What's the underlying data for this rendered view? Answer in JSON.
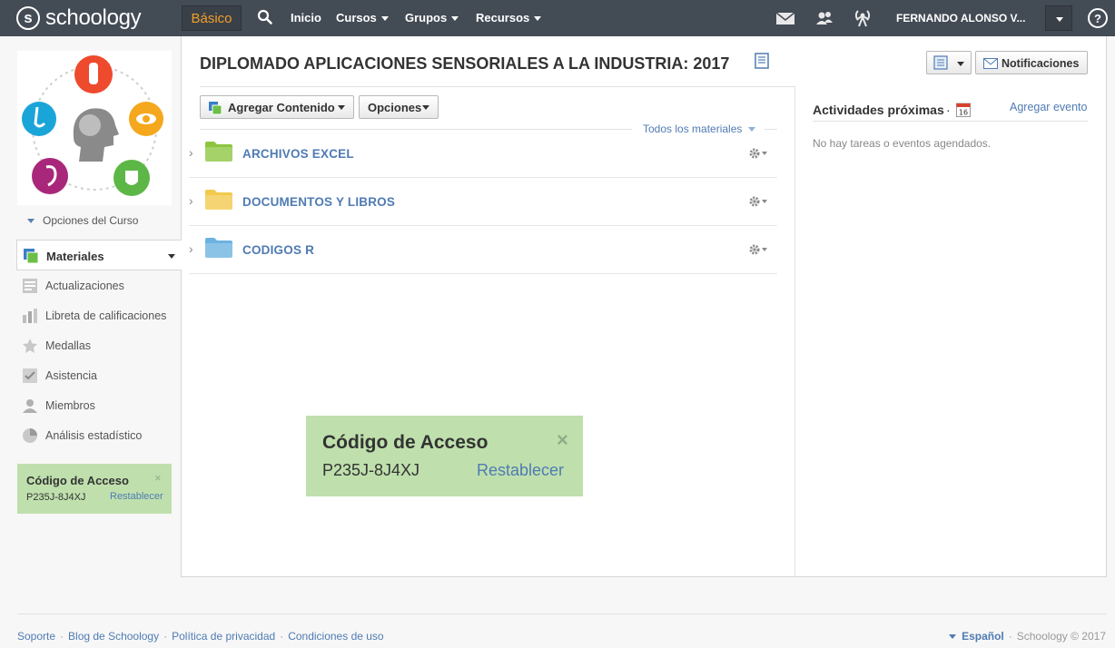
{
  "topbar": {
    "logo_letter": "s",
    "logo_text": "schoology",
    "basic_label": "Básico",
    "nav": [
      "Inicio",
      "Cursos",
      "Grupos",
      "Recursos"
    ],
    "user_name": "FERNANDO ALONSO V...",
    "help": "?"
  },
  "sidebar": {
    "course_options": "Opciones del Curso",
    "active_item": "Materiales",
    "items": [
      "Actualizaciones",
      "Libreta de calificaciones",
      "Medallas",
      "Asistencia",
      "Miembros",
      "Análisis estadístico"
    ],
    "access_code": {
      "title": "Código de Acceso",
      "code": "P235J-8J4XJ",
      "reset": "Restablecer",
      "close": "×"
    }
  },
  "main": {
    "title": "DIPLOMADO APLICACIONES SENSORIALES A LA INDUSTRIA: 2017",
    "notifications_label": "Notificaciones",
    "add_content_label": "Agregar Contenido",
    "options_label": "Opciones",
    "all_materials_label": "Todos los materiales",
    "folders": [
      {
        "name": "ARCHIVOS EXCEL",
        "color": "#8cc63f"
      },
      {
        "name": "DOCUMENTOS Y LIBROS",
        "color": "#f2c94c"
      },
      {
        "name": "CODIGOS R",
        "color": "#6bb3e0"
      }
    ],
    "access_code_popup": {
      "title": "Código de Acceso",
      "code": "P235J-8J4XJ",
      "reset": "Restablecer",
      "close": "×"
    }
  },
  "upcoming": {
    "title": "Actividades próximas",
    "calendar_day": "16",
    "add_event": "Agregar evento",
    "empty": "No hay tareas o eventos agendados."
  },
  "footer": {
    "links": [
      "Soporte",
      "Blog de Schoology",
      "Política de privacidad",
      "Condiciones de uso"
    ],
    "language": "Español",
    "copyright": "Schoology © 2017"
  },
  "colors": {
    "topbar": "#434b55",
    "accent_orange": "#f29e2b",
    "link_blue": "#4f7bb3",
    "code_green": "#bfe0ad"
  }
}
